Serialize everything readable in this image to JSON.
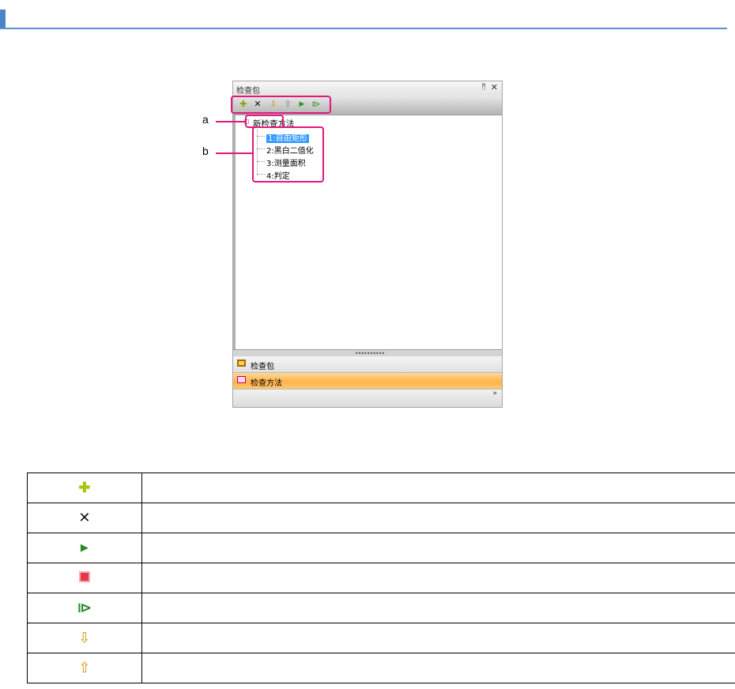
{
  "panel": {
    "title": "检查包",
    "pin": "ᛗ",
    "close": "✕",
    "toolbar": [
      {
        "name": "add-icon",
        "glyph": "✚"
      },
      {
        "name": "delete-icon",
        "glyph": "✕"
      },
      {
        "name": "move-down-icon",
        "glyph": "⇩"
      },
      {
        "name": "move-up-icon",
        "glyph": "⇧"
      },
      {
        "name": "run-icon",
        "glyph": "▶"
      },
      {
        "name": "run-all-icon",
        "glyph": "⧐"
      }
    ],
    "tree": {
      "root": "新检查方法",
      "items": [
        "1:自由矩形",
        "2:黑白二值化",
        "3:测量面积",
        "4:判定"
      ],
      "selected_index": 0
    },
    "splitter_grip": "••••••••••",
    "tabs": [
      {
        "label": "检查包",
        "icon": "package-icon"
      },
      {
        "label": "检查方法",
        "icon": "method-icon",
        "active": true
      }
    ],
    "more": "»"
  },
  "callouts": {
    "a": "a",
    "b": "b"
  },
  "legend": [
    {
      "icon": "add-icon",
      "glyph": "✚",
      "text": ""
    },
    {
      "icon": "delete-icon",
      "glyph": "✕",
      "text": ""
    },
    {
      "icon": "run-icon",
      "glyph": "▶",
      "text": ""
    },
    {
      "icon": "stop-icon",
      "glyph": "",
      "text": ""
    },
    {
      "icon": "run-all-icon",
      "glyph": "⧐",
      "text": ""
    },
    {
      "icon": "move-down-icon",
      "glyph": "⇩",
      "text": ""
    },
    {
      "icon": "move-up-icon",
      "glyph": "⇧",
      "text": ""
    }
  ],
  "colors": {
    "header_accent": "#4a86c8",
    "callout": "#e0197d",
    "selection": "#3399ff",
    "active_tab": "#ffb34a"
  }
}
